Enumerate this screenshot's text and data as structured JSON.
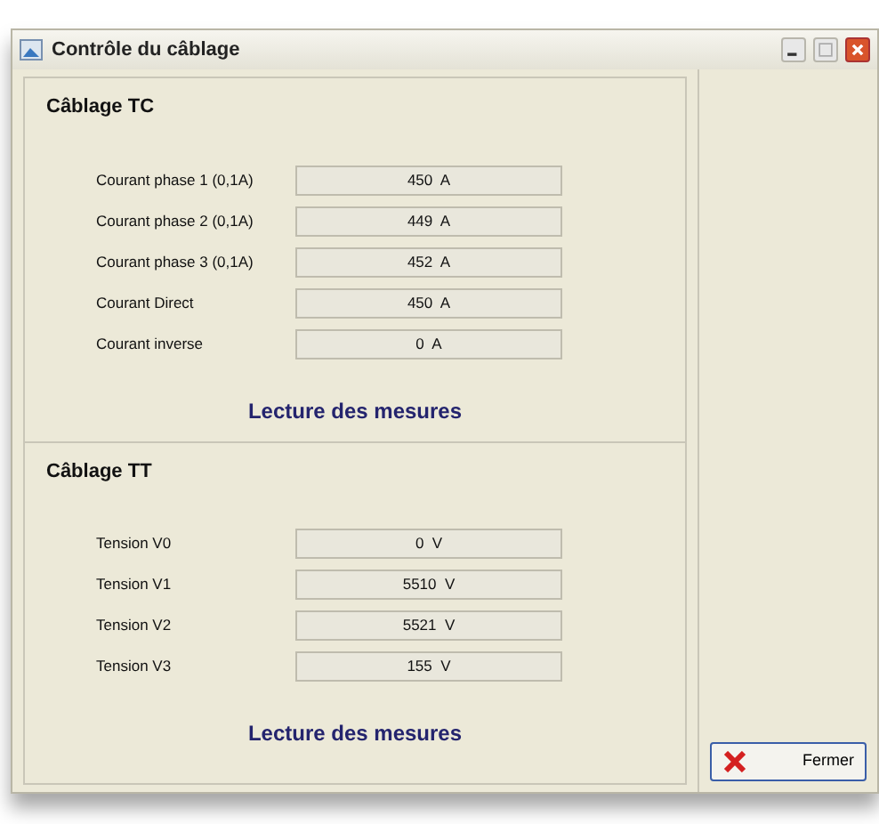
{
  "window": {
    "title": "Contrôle du câblage"
  },
  "sections": [
    {
      "title": "Câblage TC",
      "rows": [
        {
          "label": "Courant phase 1 (0,1A)",
          "value": "450  A"
        },
        {
          "label": "Courant phase 2 (0,1A)",
          "value": "449  A"
        },
        {
          "label": "Courant phase 3 (0,1A)",
          "value": "452  A"
        },
        {
          "label": "Courant Direct",
          "value": "450  A"
        },
        {
          "label": "Courant inverse",
          "value": "0  A"
        }
      ],
      "action": "Lecture des mesures"
    },
    {
      "title": "Câblage TT",
      "rows": [
        {
          "label": "Tension V0",
          "value": "0  V"
        },
        {
          "label": "Tension V1",
          "value": "5510  V"
        },
        {
          "label": "Tension V2",
          "value": "5521  V"
        },
        {
          "label": "Tension V3",
          "value": "155  V"
        }
      ],
      "action": "Lecture des mesures"
    }
  ],
  "close_button": "Fermer"
}
